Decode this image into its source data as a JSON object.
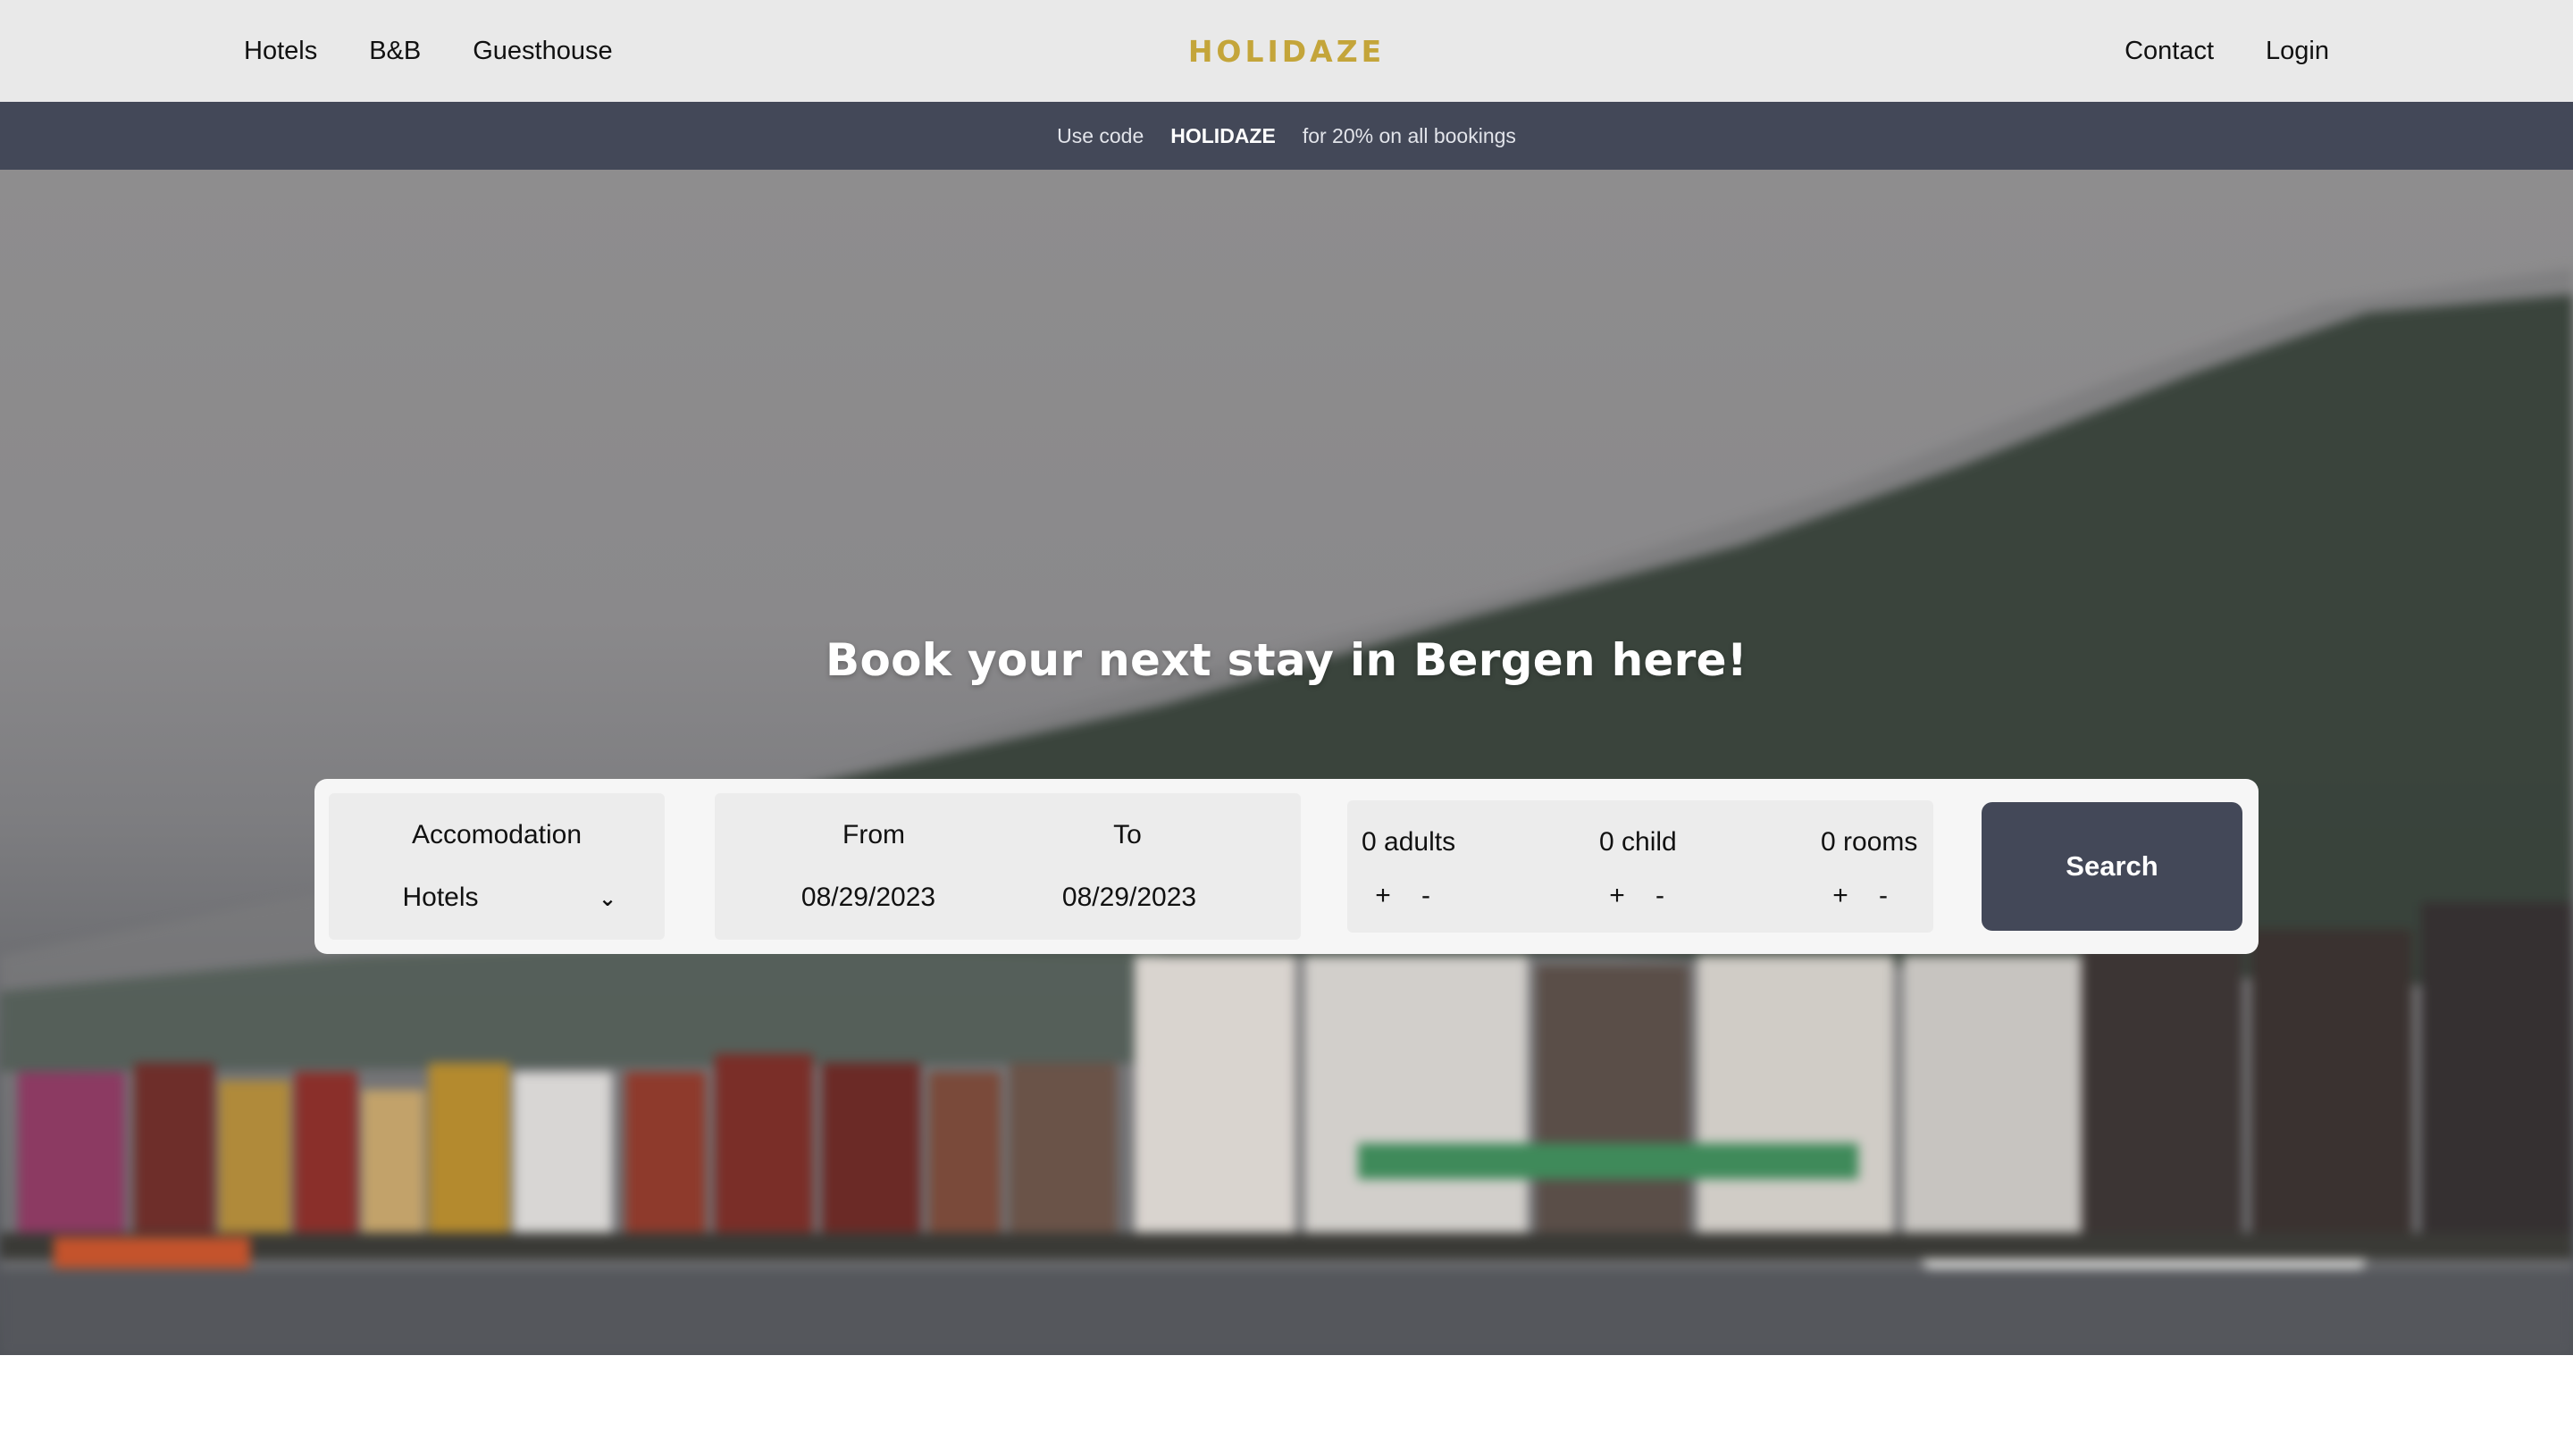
{
  "nav": {
    "left_items": [
      "Hotels",
      "B&B",
      "Guesthouse"
    ],
    "logo": "HOLIDAZE",
    "right_items": [
      "Contact",
      "Login"
    ]
  },
  "promo": {
    "prefix": "Use code",
    "code": "HOLIDAZE",
    "suffix": "for 20% on all bookings"
  },
  "hero": {
    "title": "Book your next stay in Bergen here!"
  },
  "search": {
    "accommodation_label": "Accomodation",
    "accommodation_value": "Hotels",
    "from_label": "From",
    "from_value": "08/29/2023",
    "to_label": "To",
    "to_value": "08/29/2023",
    "adults": "0 adults",
    "child": "0 child",
    "rooms": "0 rooms",
    "plus": "+",
    "minus": "-",
    "button_label": "Search"
  },
  "colors": {
    "nav_bg": "#e9e9e9",
    "promo_bg": "#434858",
    "logo": "#c4a53a",
    "search_button_bg": "#434858"
  },
  "icons": {
    "dropdown": "chevron-down-icon"
  }
}
